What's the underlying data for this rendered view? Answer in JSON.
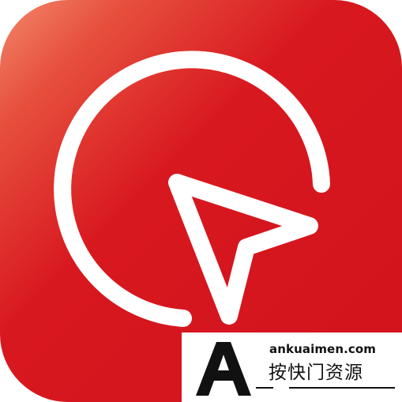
{
  "icon": {
    "name": "cursor-app-icon",
    "gradient_start": "#ef7b55",
    "gradient_end": "#d6141f",
    "glyph_color": "#ffffff"
  },
  "watermark": {
    "logo_letter": "A",
    "domain": "ankuaimen.com",
    "slogan": "按快门资源",
    "text_color": "#111111",
    "panel_color": "#ffffff"
  }
}
